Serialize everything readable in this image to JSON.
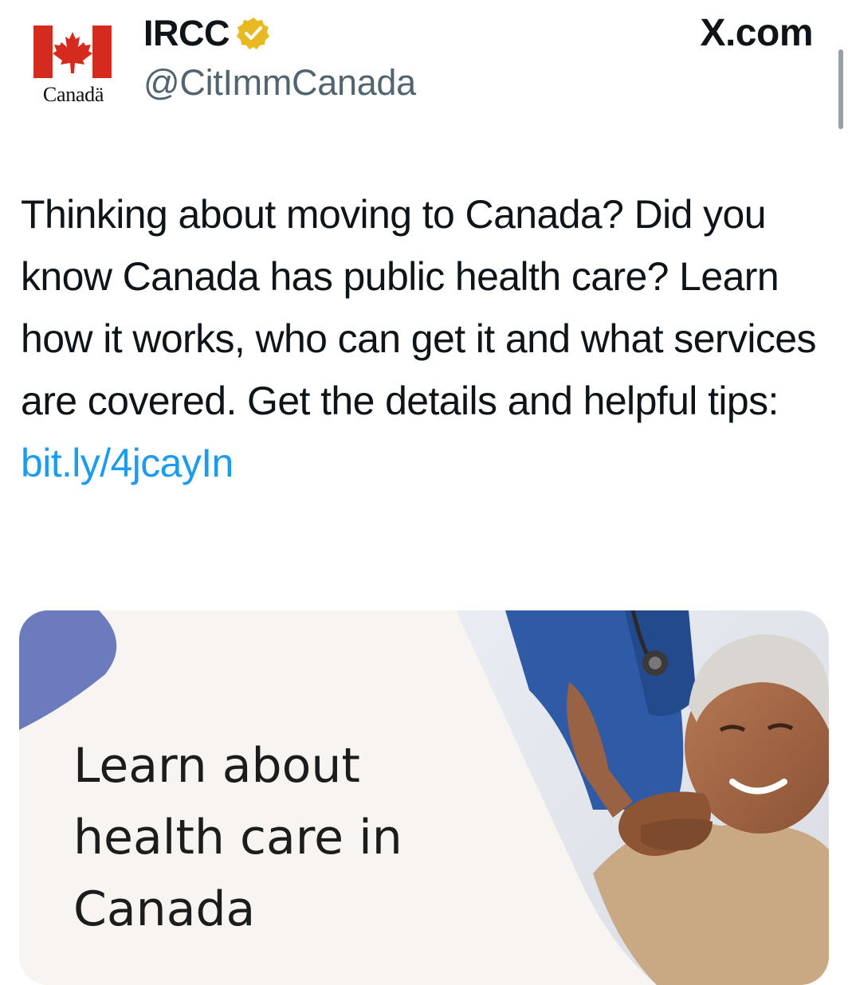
{
  "post": {
    "display_name": "IRCC",
    "handle": "@CitImmCanada",
    "source_label": "X.com",
    "avatar_wordmark": "Canad",
    "avatar_wordmark_suffix": "ä",
    "text": "Thinking about moving to Canada? Did you know Canada has public health care? Learn how it works, who can get it and what services are covered. Get the details and helpful tips: ",
    "link_text": "bit.ly/​4jcayIn"
  },
  "card": {
    "headline_line1": "Learn about",
    "headline_line2": "health care in",
    "headline_line3": "Canada"
  },
  "colors": {
    "link": "#1d9bf0",
    "verified_badge": "#e8b923",
    "flag_red": "#d52b1e",
    "card_accent": "#6b7bbd"
  },
  "icons": {
    "verified": "verified-badge-icon",
    "flag": "canada-flag-icon"
  }
}
